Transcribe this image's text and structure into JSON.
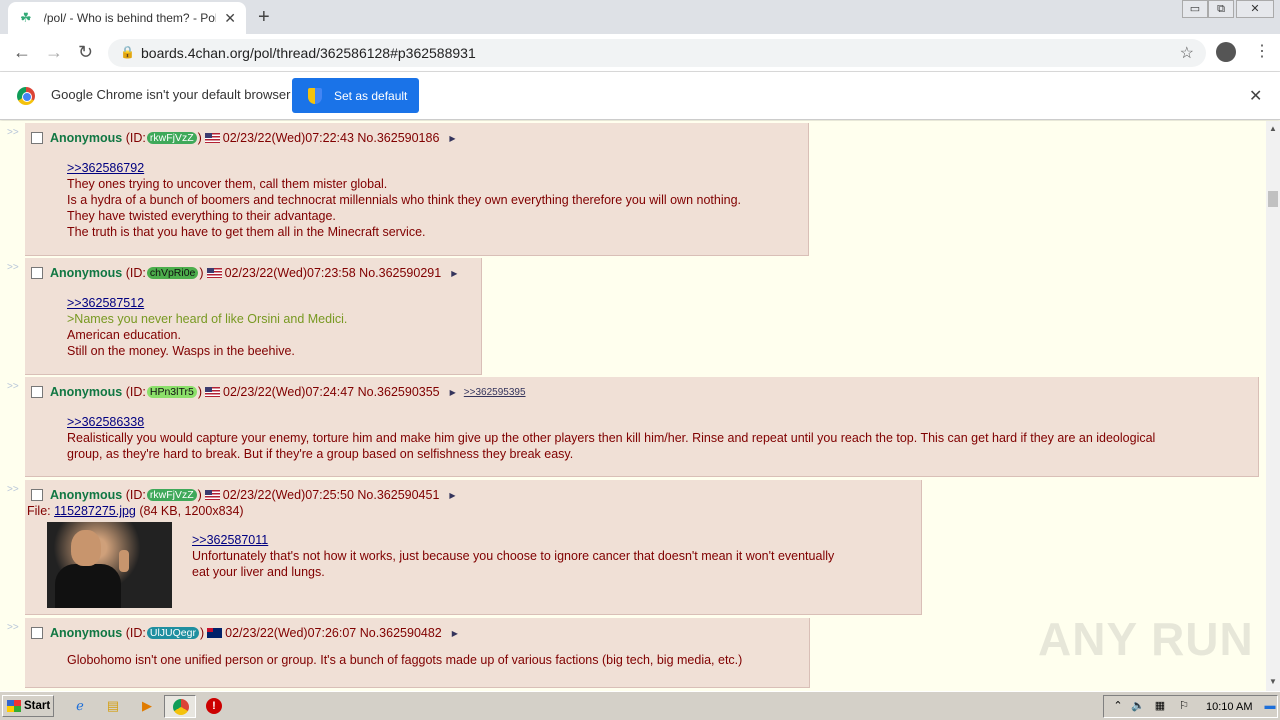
{
  "browser": {
    "tab_title": "/pol/ - Who is behind them? - Politica",
    "new_tab": "+",
    "url": "boards.4chan.org/pol/thread/362586128#p362588931",
    "infobar_text": "Google Chrome isn't your default browser",
    "set_default_label": "Set as default",
    "window_controls": [
      "▭",
      "⧉",
      "✕"
    ]
  },
  "posts": [
    {
      "name": "Anonymous",
      "id_prefix": "(ID: ",
      "id": "rkwFjVzZ",
      "id_suffix": ")",
      "id_color": "#3fa95a",
      "flag": "US",
      "datetime": "02/23/22(Wed)07:22:43",
      "number": "No.362590186",
      "quote": ">>362586792",
      "lines": [
        {
          "text": "They ones trying to uncover them, call them mister global.",
          "green": false
        },
        {
          "text": "Is a hydra of a bunch of boomers and technocrat millennials who think they own everything therefore you will own nothing.",
          "green": false
        },
        {
          "text": "They have twisted everything to their advantage.",
          "green": false
        },
        {
          "text": "The truth is that you have to get them all in the Minecraft service.",
          "green": false
        }
      ]
    },
    {
      "name": "Anonymous",
      "id_prefix": "(ID: ",
      "id": "chVpRi0e",
      "id_suffix": ")",
      "id_color": "#4cae4c",
      "flag": "US",
      "datetime": "02/23/22(Wed)07:23:58",
      "number": "No.362590291",
      "quote": ">>362587512",
      "lines": [
        {
          "text": ">Names you never heard of like Orsini and Medici.",
          "green": true
        },
        {
          "text": "American education.",
          "green": false
        },
        {
          "text": "Still on the money. Wasps in the beehive.",
          "green": false
        }
      ]
    },
    {
      "name": "Anonymous",
      "id_prefix": "(ID: ",
      "id": "HPn3lTr5",
      "id_suffix": ")",
      "id_color": "#8ce06a",
      "flag": "US",
      "datetime": "02/23/22(Wed)07:24:47",
      "number": "No.362590355",
      "backlink": ">>362595395",
      "quote": ">>362586338",
      "lines": [
        {
          "text": "Realistically you would capture your enemy, torture him and make him give up the other players then kill him/her. Rinse and repeat until you reach the top. This can get hard if they are an ideological",
          "green": false
        },
        {
          "text": "group, as they're hard to break. But if they're a group based on selfishness they break easy.",
          "green": false
        }
      ]
    },
    {
      "name": "Anonymous",
      "id_prefix": "(ID: ",
      "id": "rkwFjVzZ",
      "id_suffix": ")",
      "id_color": "#3fa95a",
      "flag": "US",
      "datetime": "02/23/22(Wed)07:25:50",
      "number": "No.362590451",
      "file_label": "File: ",
      "file_name": "115287275.jpg",
      "file_meta": " (84 KB, 1200x834)",
      "quote": ">>362587011",
      "lines": [
        {
          "text": "Unfortunately that's not how it works, just because you choose to ignore cancer that doesn't mean it won't eventually",
          "green": false
        },
        {
          "text": "eat your liver and lungs.",
          "green": false
        }
      ]
    },
    {
      "name": "Anonymous",
      "id_prefix": "(ID: ",
      "id": "UlJUQegr",
      "id_suffix": ")",
      "id_color": "#1f8fa0",
      "flag": "AU",
      "datetime": "02/23/22(Wed)07:26:07",
      "number": "No.362590482",
      "lines": [
        {
          "text": "Globohomo isn't one unified person or group. It's a bunch of faggots made up of various factions (big tech, big media, etc.)",
          "green": false
        }
      ]
    }
  ],
  "side_arrows": ">>",
  "watermark": "ANY RUN",
  "taskbar": {
    "start_label": "Start",
    "clock": "10:10 AM"
  }
}
